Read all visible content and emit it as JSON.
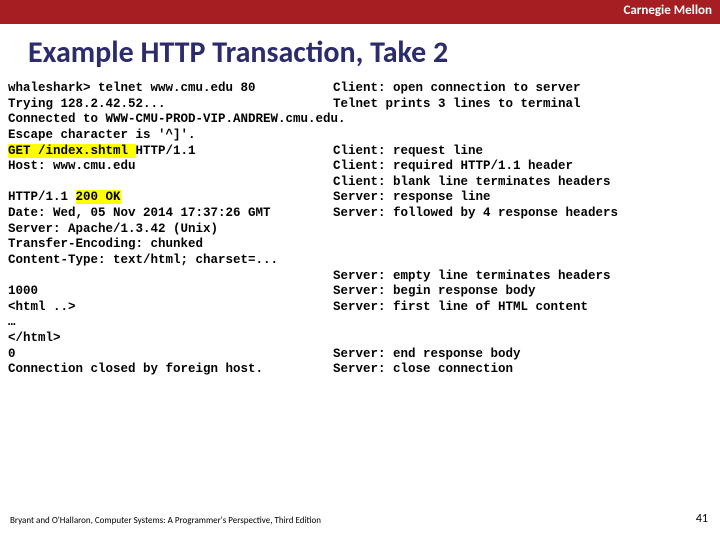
{
  "university": "Carnegie Mellon",
  "title": "Example HTTP Transaction, Take 2",
  "lines": {
    "l1l": "whaleshark> telnet www.cmu.edu 80",
    "l1a": "Client:",
    "l1r": " open connection to server",
    "l2l": "Trying 128.2.42.52...",
    "l2a": "Telnet",
    "l2r": " prints 3 lines to terminal",
    "l3l": "Connected to WWW-CMU-PROD-VIP.ANDREW.cmu.edu.",
    "l4l": "Escape character is '^]'.",
    "l5pre": "GET /index.shtml ",
    "l5post": "HTTP/1.1",
    "l5a": "Client:",
    "l5r": " request line",
    "l6l": "Host: www.cmu.edu",
    "l6a": "Client:",
    "l6r": " required HTTP/1.1 header",
    "l7a": "Client:",
    "l7r": " blank line terminates headers",
    "l8pre": "HTTP/1.1 ",
    "l8hl": "200 OK",
    "l8a": "Server:",
    "l8r": " response line",
    "l9l": "Date: Wed, 05 Nov 2014 17:37:26 GMT",
    "l9a": "Server:",
    "l9r": " followed by 4 response headers",
    "l10l": "Server: Apache/1.3.42 (Unix)",
    "l11l": "Transfer-Encoding: chunked",
    "l12l": "Content-Type: text/html; charset=...",
    "l13a": "Server:",
    "l13r": " empty line terminates headers",
    "l14l": "1000",
    "l14a": "Server:",
    "l14r": " begin response body",
    "l15l": "<html ..>",
    "l15a": "Server:",
    "l15r": " first line of HTML content",
    "l16l": "…",
    "l17l": "</html>",
    "l18l": "0",
    "l18a": "Server:",
    "l18r": " end response body",
    "l19l": "Connection closed by foreign host.",
    "l19a": "Server:",
    "l19r": " close connection"
  },
  "footer": "Bryant and O'Hallaron, Computer Systems: A Programmer's Perspective, Third Edition",
  "page": "41"
}
